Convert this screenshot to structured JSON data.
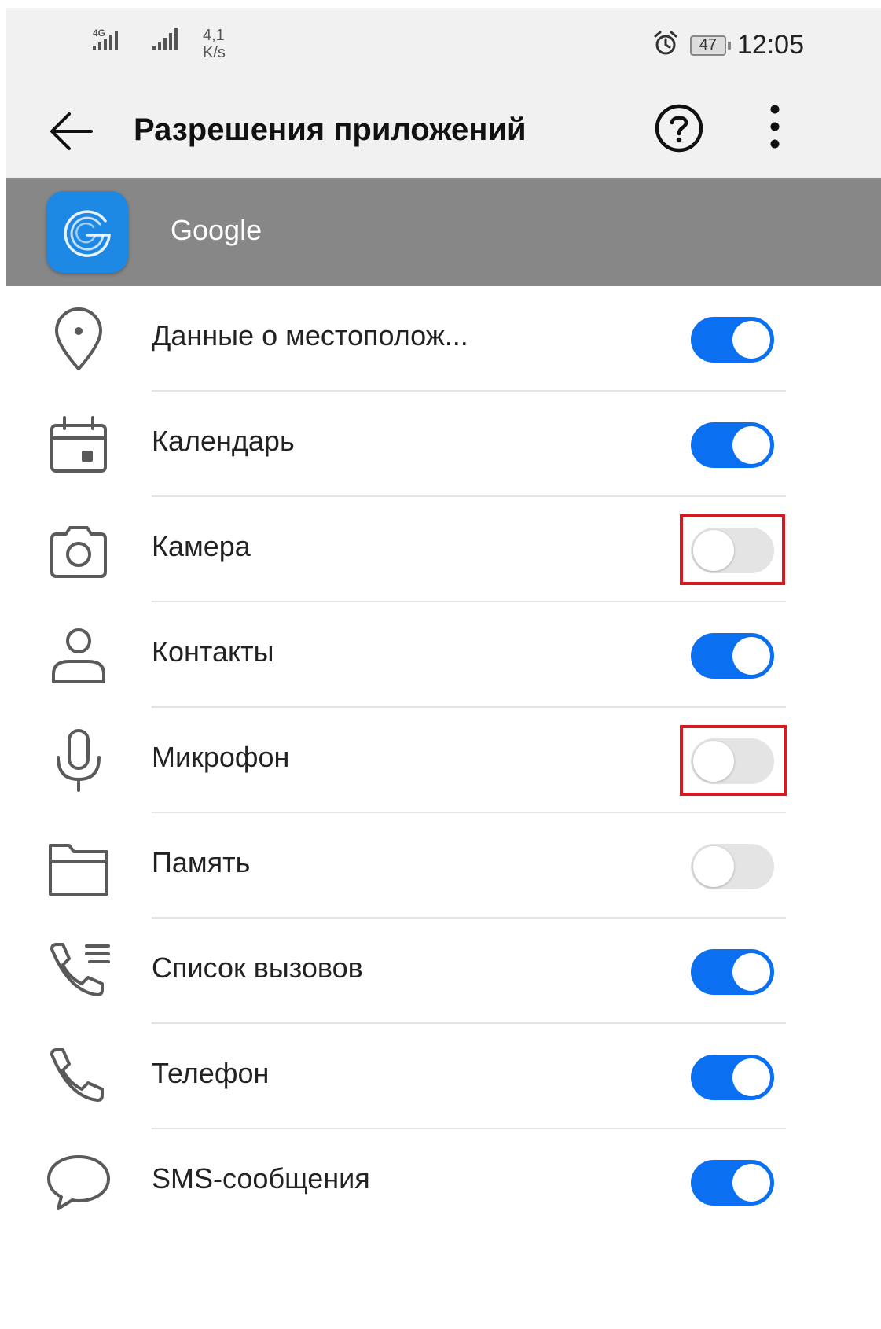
{
  "status_bar": {
    "network_label": "4G",
    "speed_value": "4,1",
    "speed_unit": "K/s",
    "battery": "47",
    "time": "12:05",
    "icons": [
      "signal-icon",
      "signal-icon",
      "alarm-icon",
      "battery-icon"
    ]
  },
  "header": {
    "title": "Разрешения приложений",
    "back_icon": "arrow-left-icon",
    "help_icon": "question-circle-icon",
    "menu_icon": "more-vertical-icon"
  },
  "app": {
    "name": "Google",
    "icon_color": "#1e88e5"
  },
  "accent_color": "#0a6ff0",
  "highlight_color": "#d71920",
  "permissions": [
    {
      "label": "Данные о местополож...",
      "icon": "location-pin-icon",
      "enabled": true,
      "highlighted": false
    },
    {
      "label": "Календарь",
      "icon": "calendar-icon",
      "enabled": true,
      "highlighted": false
    },
    {
      "label": "Камера",
      "icon": "camera-icon",
      "enabled": false,
      "highlighted": true
    },
    {
      "label": "Контакты",
      "icon": "person-icon",
      "enabled": true,
      "highlighted": false
    },
    {
      "label": "Микрофон",
      "icon": "microphone-icon",
      "enabled": false,
      "highlighted": true
    },
    {
      "label": "Память",
      "icon": "folder-icon",
      "enabled": false,
      "highlighted": false
    },
    {
      "label": "Список вызовов",
      "icon": "call-log-icon",
      "enabled": true,
      "highlighted": false
    },
    {
      "label": "Телефон",
      "icon": "phone-icon",
      "enabled": true,
      "highlighted": false
    },
    {
      "label": "SMS-сообщения",
      "icon": "message-bubble-icon",
      "enabled": true,
      "highlighted": false
    }
  ]
}
